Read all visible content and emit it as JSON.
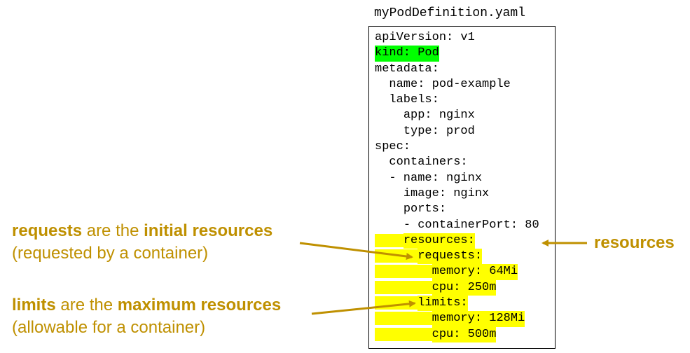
{
  "file_title": "myPodDefinition.yaml",
  "yaml_lines": [
    {
      "indent": "",
      "text": "apiVersion: v1",
      "highlight": "none"
    },
    {
      "indent": "",
      "text": "kind: Pod",
      "highlight": "green"
    },
    {
      "indent": "",
      "text": "metadata:",
      "highlight": "none"
    },
    {
      "indent": "  ",
      "text": "name: pod-example",
      "highlight": "none"
    },
    {
      "indent": "  ",
      "text": "labels:",
      "highlight": "none"
    },
    {
      "indent": "    ",
      "text": "app: nginx",
      "highlight": "none"
    },
    {
      "indent": "    ",
      "text": "type: prod",
      "highlight": "none"
    },
    {
      "indent": "",
      "text": "spec:",
      "highlight": "none"
    },
    {
      "indent": "  ",
      "text": "containers:",
      "highlight": "none"
    },
    {
      "indent": "  ",
      "text": "- name: nginx",
      "highlight": "none"
    },
    {
      "indent": "    ",
      "text": "image: nginx",
      "highlight": "none"
    },
    {
      "indent": "    ",
      "text": "ports:",
      "highlight": "none"
    },
    {
      "indent": "    ",
      "text": "- containerPort: 80",
      "highlight": "none"
    },
    {
      "indent": "    ",
      "text": "resources:",
      "highlight": "yellow"
    },
    {
      "indent": "      ",
      "text": "requests:",
      "highlight": "yellow"
    },
    {
      "indent": "        ",
      "text": "memory: 64Mi",
      "highlight": "yellow"
    },
    {
      "indent": "        ",
      "text": "cpu: 250m",
      "highlight": "yellow"
    },
    {
      "indent": "      ",
      "text": "limits:",
      "highlight": "yellow"
    },
    {
      "indent": "        ",
      "text": "memory: 128Mi",
      "highlight": "yellow"
    },
    {
      "indent": "        ",
      "text": "cpu: 500m",
      "highlight": "yellow"
    }
  ],
  "annotations": {
    "resources": "resources",
    "requests": {
      "line1_bold_a": "requests",
      "line1_mid": " are the ",
      "line1_bold_b": "initial resources",
      "line2": "(requested by a container)"
    },
    "limits": {
      "line1_bold_a": "limits",
      "line1_mid": " are the ",
      "line1_bold_b": "maximum resources",
      "line2": "(allowable for a container)"
    }
  },
  "colors": {
    "annotation": "#bf9000",
    "highlight_green": "#00ff00",
    "highlight_yellow": "#ffff00",
    "border": "#000000"
  }
}
